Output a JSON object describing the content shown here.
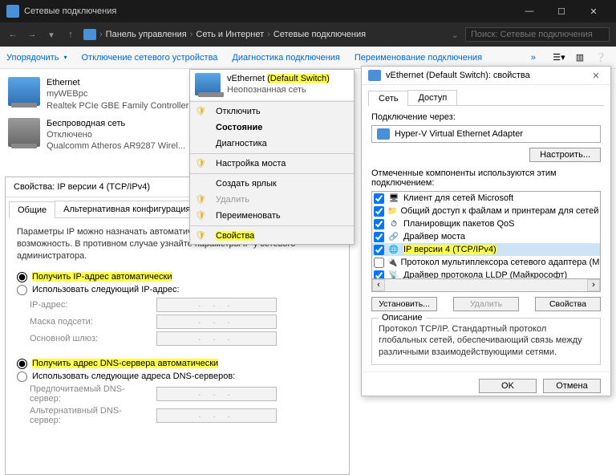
{
  "window": {
    "title": "Сетевые подключения"
  },
  "nav": {
    "crumbs": [
      "Панель управления",
      "Сеть и Интернет",
      "Сетевые подключения"
    ],
    "search_placeholder": "Поиск: Сетевые подключения"
  },
  "toolbar": {
    "organize": "Упорядочить",
    "disable": "Отключение сетевого устройства",
    "diagnose": "Диагностика подключения",
    "rename": "Переименование подключения"
  },
  "connections": [
    {
      "name": "Ethernet",
      "network": "myWEBpc",
      "device": "Realtek PCIe GBE Family Controller"
    },
    {
      "name": "vEthernet (Default Switch)",
      "network": "Неопознанная сеть",
      "device": ""
    },
    {
      "name": "Беспроводная сеть",
      "network": "Отключено",
      "device": "Qualcomm Atheros AR9287 Wirel..."
    }
  ],
  "ctx": {
    "items": [
      {
        "label": "Отключить",
        "shield": true
      },
      {
        "label": "Состояние",
        "shield": false,
        "bold": true
      },
      {
        "label": "Диагностика",
        "shield": false
      },
      {
        "sep": true
      },
      {
        "label": "Настройка моста",
        "shield": true
      },
      {
        "sep": true
      },
      {
        "label": "Создать ярлык",
        "shield": false
      },
      {
        "label": "Удалить",
        "shield": true
      },
      {
        "label": "Переименовать",
        "shield": true
      },
      {
        "sep": true
      },
      {
        "label": "Свойства",
        "shield": true,
        "highlight": true
      }
    ]
  },
  "ipv4_dialog": {
    "title": "Свойства: IP версии 4 (TCP/IPv4)",
    "tab_general": "Общие",
    "tab_alt": "Альтернативная конфигурация",
    "description": "Параметры IP можно назначать автоматически, если сеть поддерживает эту возможность. В противном случае узнайте параметры IP у сетевого администратора.",
    "r_auto_ip": "Получить IP-адрес автоматически",
    "r_manual_ip": "Использовать следующий IP-адрес:",
    "f_ip": "IP-адрес:",
    "f_mask": "Маска подсети:",
    "f_gw": "Основной шлюз:",
    "r_auto_dns": "Получить адрес DNS-сервера автоматически",
    "r_manual_dns": "Использовать следующие адреса DNS-серверов:",
    "f_dns1": "Предпочитаемый DNS-сервер:",
    "f_dns2": "Альтернативный DNS-сервер:"
  },
  "veth_dialog": {
    "title": "vEthernet (Default Switch): свойства",
    "tab_net": "Сеть",
    "tab_access": "Доступ",
    "conn_via": "Подключение через:",
    "adapter": "Hyper-V Virtual Ethernet Adapter",
    "configure_btn": "Настроить...",
    "components_label": "Отмеченные компоненты используются этим подключением:",
    "components": [
      {
        "checked": true,
        "icon": "🖥",
        "label": "Клиент для сетей Microsoft"
      },
      {
        "checked": true,
        "icon": "📁",
        "label": "Общий доступ к файлам и принтерам для сетей Mi"
      },
      {
        "checked": true,
        "icon": "⏱",
        "label": "Планировщик пакетов QoS"
      },
      {
        "checked": true,
        "icon": "🔗",
        "label": "Драйвер моста"
      },
      {
        "checked": true,
        "icon": "🌐",
        "label": "IP версии 4 (TCP/IPv4)",
        "selected": true
      },
      {
        "checked": false,
        "icon": "🔌",
        "label": "Протокол мультиплексора сетевого адаптера (Ма"
      },
      {
        "checked": true,
        "icon": "📡",
        "label": "Драйвер протокола LLDP (Майкрософт)"
      }
    ],
    "btn_install": "Установить...",
    "btn_remove": "Удалить",
    "btn_props": "Свойства",
    "desc_legend": "Описание",
    "desc_text": "Протокол TCP/IP. Стандартный протокол глобальных сетей, обеспечивающий связь между различными взаимодействующими сетями.",
    "ok": "OK",
    "cancel": "Отмена"
  }
}
